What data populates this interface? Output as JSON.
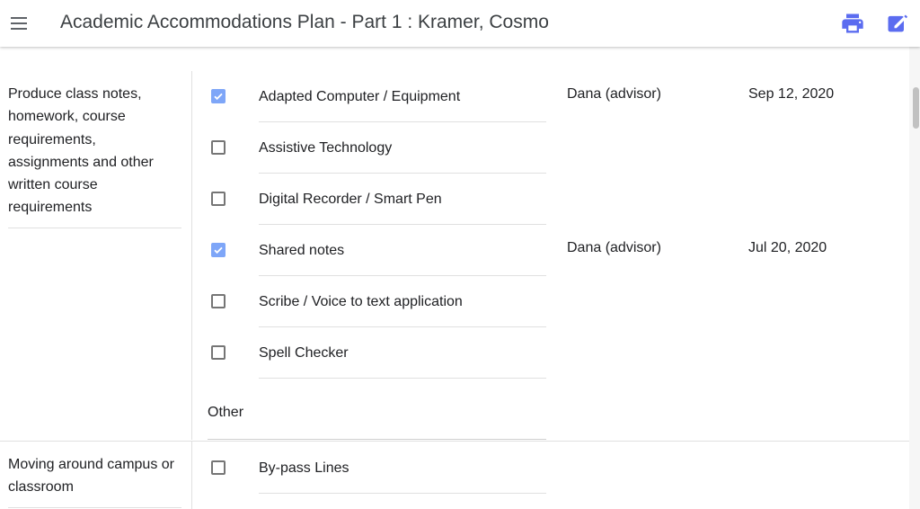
{
  "app": {
    "title": "Academic Accommodations Plan - Part 1 : Kramer, Cosmo",
    "menu_icon": "hamburger-menu-icon",
    "print_icon": "printer-icon",
    "edit_icon": "edit-note-icon",
    "accent_color": "#5b6cf0",
    "checkbox_checked_color": "#7ea6f8"
  },
  "sections": [
    {
      "category": "Produce class notes, homework, course requirements, assignments and other written course requirements",
      "options": [
        {
          "label": "Adapted Computer / Equipment",
          "checked": true,
          "approved_by": "Dana (advisor)",
          "date": "Sep 12, 2020"
        },
        {
          "label": "Assistive Technology",
          "checked": false
        },
        {
          "label": "Digital Recorder / Smart Pen",
          "checked": false
        },
        {
          "label": "Shared notes",
          "checked": true,
          "approved_by": "Dana (advisor)",
          "date": "Jul 20, 2020"
        },
        {
          "label": "Scribe / Voice to text application",
          "checked": false
        },
        {
          "label": "Spell Checker",
          "checked": false
        }
      ],
      "other_label": "Other"
    },
    {
      "category": "Moving around campus or classroom",
      "options": [
        {
          "label": "By-pass Lines",
          "checked": false
        }
      ]
    }
  ]
}
